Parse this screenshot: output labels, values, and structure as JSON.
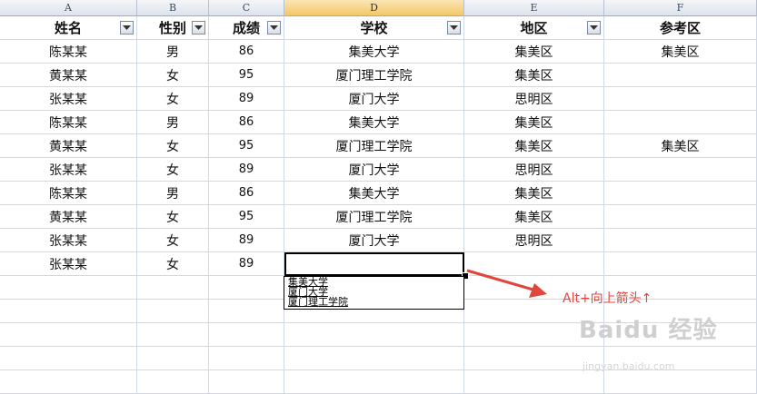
{
  "columns": [
    "A",
    "B",
    "C",
    "D",
    "E",
    "F"
  ],
  "selected_column": "D",
  "headers": [
    "姓名",
    "性别",
    "成绩",
    "学校",
    "地区",
    "参考区"
  ],
  "rows": [
    [
      "陈某某",
      "男",
      "86",
      "集美大学",
      "集美区",
      "集美区"
    ],
    [
      "黄某某",
      "女",
      "95",
      "厦门理工学院",
      "集美区",
      ""
    ],
    [
      "张某某",
      "女",
      "89",
      "厦门大学",
      "思明区",
      ""
    ],
    [
      "陈某某",
      "男",
      "86",
      "集美大学",
      "集美区",
      ""
    ],
    [
      "黄某某",
      "女",
      "95",
      "厦门理工学院",
      "集美区",
      "集美区"
    ],
    [
      "张某某",
      "女",
      "89",
      "厦门大学",
      "思明区",
      ""
    ],
    [
      "陈某某",
      "男",
      "86",
      "集美大学",
      "集美区",
      ""
    ],
    [
      "黄某某",
      "女",
      "95",
      "厦门理工学院",
      "集美区",
      ""
    ],
    [
      "张某某",
      "女",
      "89",
      "厦门大学",
      "思明区",
      ""
    ],
    [
      "张某某",
      "女",
      "89",
      "",
      "",
      ""
    ]
  ],
  "dropdown_options": [
    "集美大学",
    "厦门大学",
    "厦门理工学院"
  ],
  "annotation": "Alt+向上箭头↑",
  "annotation_color": "#e1463c",
  "watermark": "Baidu 经验",
  "watermark_url": "jingyan.baidu.com",
  "icons": {
    "filter": "filter-dropdown-icon",
    "arrow": "red-arrow-icon"
  }
}
